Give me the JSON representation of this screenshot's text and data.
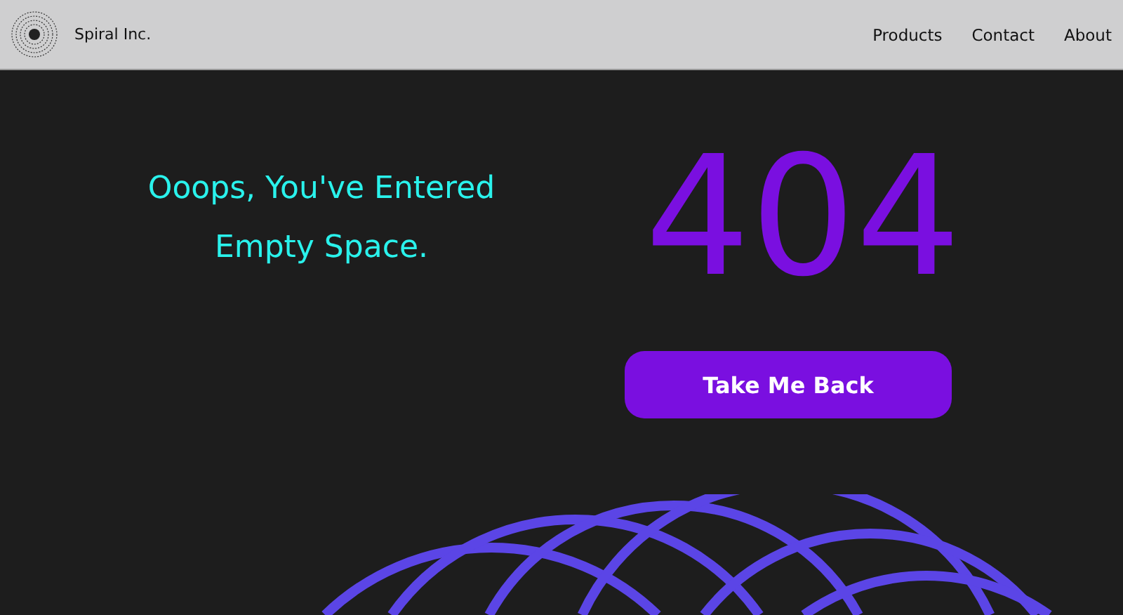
{
  "header": {
    "brand": "Spiral Inc.",
    "nav": [
      {
        "label": "Products"
      },
      {
        "label": "Contact"
      },
      {
        "label": "About"
      }
    ]
  },
  "hero": {
    "message": "Ooops, You've Entered Empty Space.",
    "code": "404",
    "button": "Take Me Back"
  }
}
